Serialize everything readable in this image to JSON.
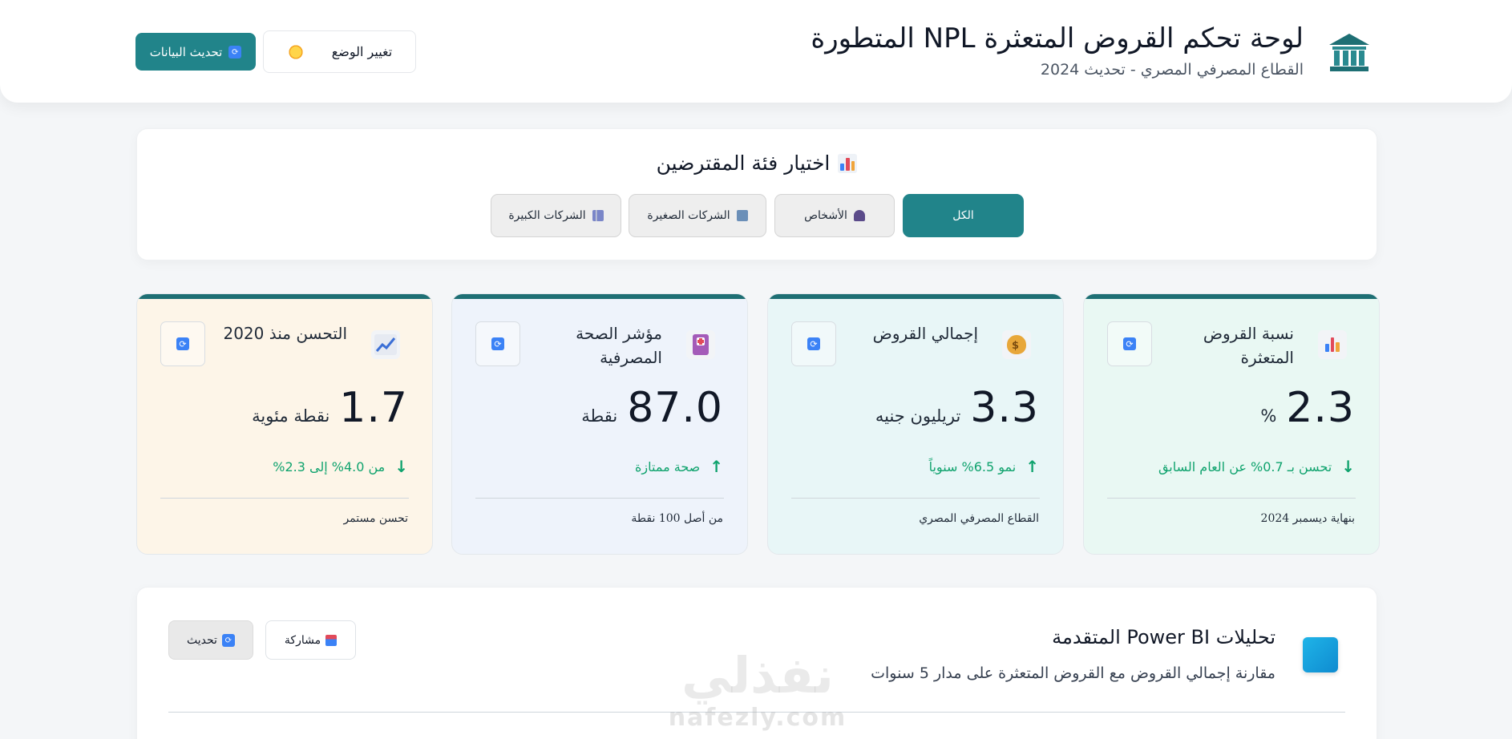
{
  "header": {
    "title": "لوحة تحكم القروض المتعثرة NPL المتطورة",
    "subtitle": "القطاع المصرفي المصري - تحديث 2024",
    "theme_button": "تغيير الوضع",
    "refresh_button": "تحديث البيانات",
    "icons": {
      "logo": "bank-icon",
      "theme": "sun-icon",
      "refresh": "sync-icon"
    }
  },
  "selector": {
    "title": "اختيار فئة المقترضين",
    "options": [
      "الكل",
      "الأشخاص",
      "الشركات الصغيرة",
      "الشركات الكبيرة"
    ],
    "selected": "الكل"
  },
  "cards": [
    {
      "title": "نسبة القروض المتعثرة",
      "icon": "bar-chart-icon",
      "value": "2.3",
      "unit": "%",
      "trend": "تحسن بـ 0.7% عن العام السابق",
      "trend_direction": "down",
      "footer": "بنهاية ديسمبر 2024",
      "bg": "#e9f8f3"
    },
    {
      "title": "إجمالي القروض",
      "icon": "money-bag-icon",
      "value": "3.3",
      "unit": "تريليون جنيه",
      "trend": "نمو 6.5% سنوياً",
      "trend_direction": "up",
      "footer": "القطاع المصرفي المصري",
      "bg": "#e8f6f7"
    },
    {
      "title": "مؤشر الصحة المصرفية",
      "icon": "health-icon",
      "value": "87.0",
      "unit": "نقطة",
      "trend": "صحة ممتازة",
      "trend_direction": "up",
      "footer": "من أصل 100 نقطة",
      "bg": "#eef3fb"
    },
    {
      "title": "التحسن منذ 2020",
      "icon": "trend-up-icon",
      "value": "1.7",
      "unit": "نقطة مئوية",
      "trend": "من 4.0% إلى 2.3%",
      "trend_direction": "down",
      "footer": "تحسن مستمر",
      "bg": "#fdf5e8"
    }
  ],
  "analytics": {
    "title": "تحليلات Power BI المتقدمة",
    "subtitle": "مقارنة إجمالي القروض مع القروض المتعثرة على مدار 5 سنوات",
    "share_button": "مشاركة",
    "update_button": "تحديث",
    "icon": "power-bi-icon"
  },
  "watermark": {
    "arabic": "نفذلي",
    "latin": "nafezly.com"
  },
  "colors": {
    "primary": "#21848a",
    "card_top": "#1e6f74",
    "success": "#10a36e"
  }
}
